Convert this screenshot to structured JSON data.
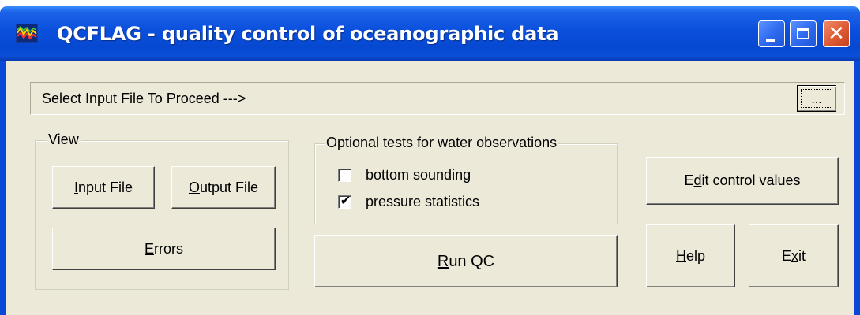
{
  "window": {
    "title": "QCFLAG - quality control of oceanographic data",
    "titlebar_color": "#0a4fdc",
    "icons": {
      "app": "chart-wave-icon",
      "minimize": "minimize-icon",
      "maximize": "maximize-icon",
      "close": "close-icon"
    },
    "close_glyph": "✕"
  },
  "file": {
    "label": "Select Input File To Proceed --->",
    "browse_label": "..."
  },
  "view": {
    "legend": "View",
    "input_button": {
      "pre": "",
      "ul": "I",
      "post": "nput File"
    },
    "output_button": {
      "pre": "",
      "ul": "O",
      "post": "utput File"
    },
    "errors_button": {
      "pre": "",
      "ul": "E",
      "post": "rrors"
    }
  },
  "optional_tests": {
    "legend": "Optional tests for water observations",
    "items": [
      {
        "label": "bottom sounding",
        "checked": false,
        "mark": ""
      },
      {
        "label": "pressure statistics",
        "checked": true,
        "mark": "✔"
      }
    ]
  },
  "actions": {
    "run_qc": {
      "pre": "",
      "ul": "R",
      "post": "un QC"
    },
    "edit_control": {
      "pre": "E",
      "ul": "d",
      "post": "it control values"
    },
    "help": {
      "pre": "",
      "ul": "H",
      "post": "elp"
    },
    "exit": {
      "pre": "E",
      "ul": "x",
      "post": "it"
    }
  }
}
